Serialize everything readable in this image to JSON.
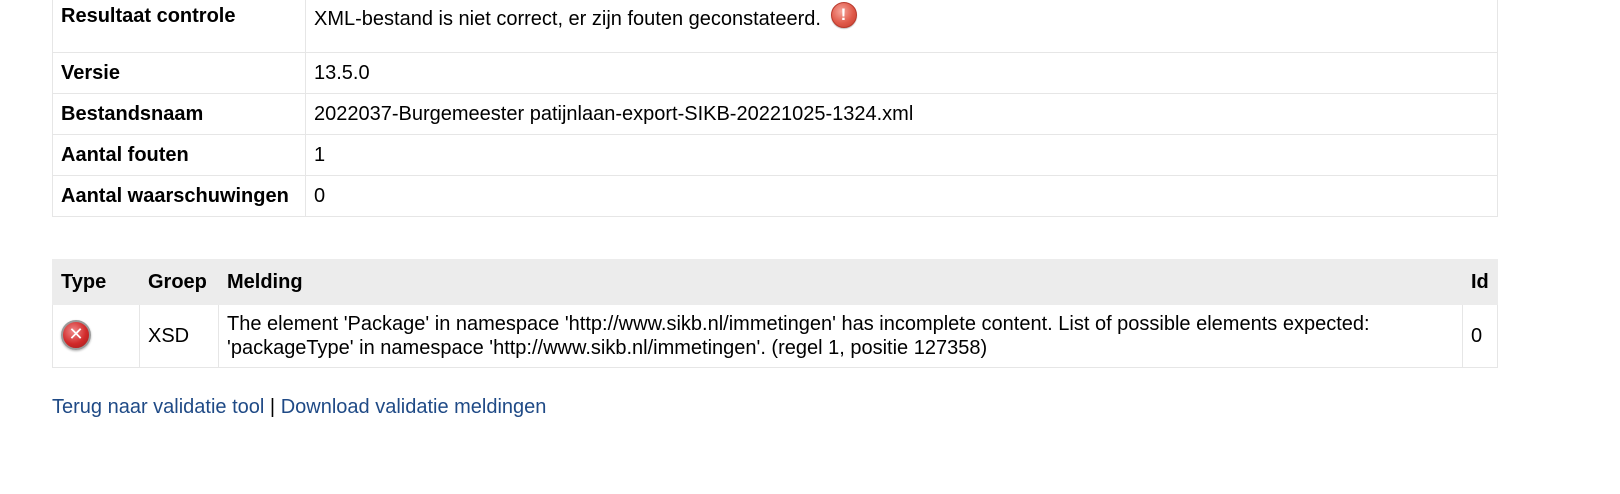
{
  "summary": {
    "rows": [
      {
        "label": "Resultaat controle",
        "value": "XML-bestand is niet correct, er zijn fouten geconstateerd."
      },
      {
        "label": "Versie",
        "value": "13.5.0"
      },
      {
        "label": "Bestandsnaam",
        "value": "2022037-Burgemeester patijnlaan-export-SIKB-20221025-1324.xml"
      },
      {
        "label": "Aantal fouten",
        "value": "1"
      },
      {
        "label": "Aantal waarschuwingen",
        "value": "0"
      }
    ],
    "result_icon": "warning-icon",
    "result_icon_glyph": "!"
  },
  "messages": {
    "headers": {
      "type": "Type",
      "groep": "Groep",
      "melding": "Melding",
      "id": "Id"
    },
    "rows": [
      {
        "type_icon": "error-icon",
        "type_icon_glyph": "✕",
        "groep": "XSD",
        "melding": "The element 'Package' in namespace 'http://www.sikb.nl/immetingen' has incomplete content. List of possible elements expected: 'packageType' in namespace 'http://www.sikb.nl/immetingen'. (regel 1, positie 127358)",
        "id": "0"
      }
    ]
  },
  "links": {
    "back_label": "Terug naar validatie tool",
    "separator": "|",
    "download_label": "Download validatie meldingen"
  },
  "colors": {
    "link": "#1f4a86",
    "header_bg": "#ececec",
    "border": "#e6e6e6",
    "error": "#d12a2a",
    "warning": "#e05a4a"
  }
}
